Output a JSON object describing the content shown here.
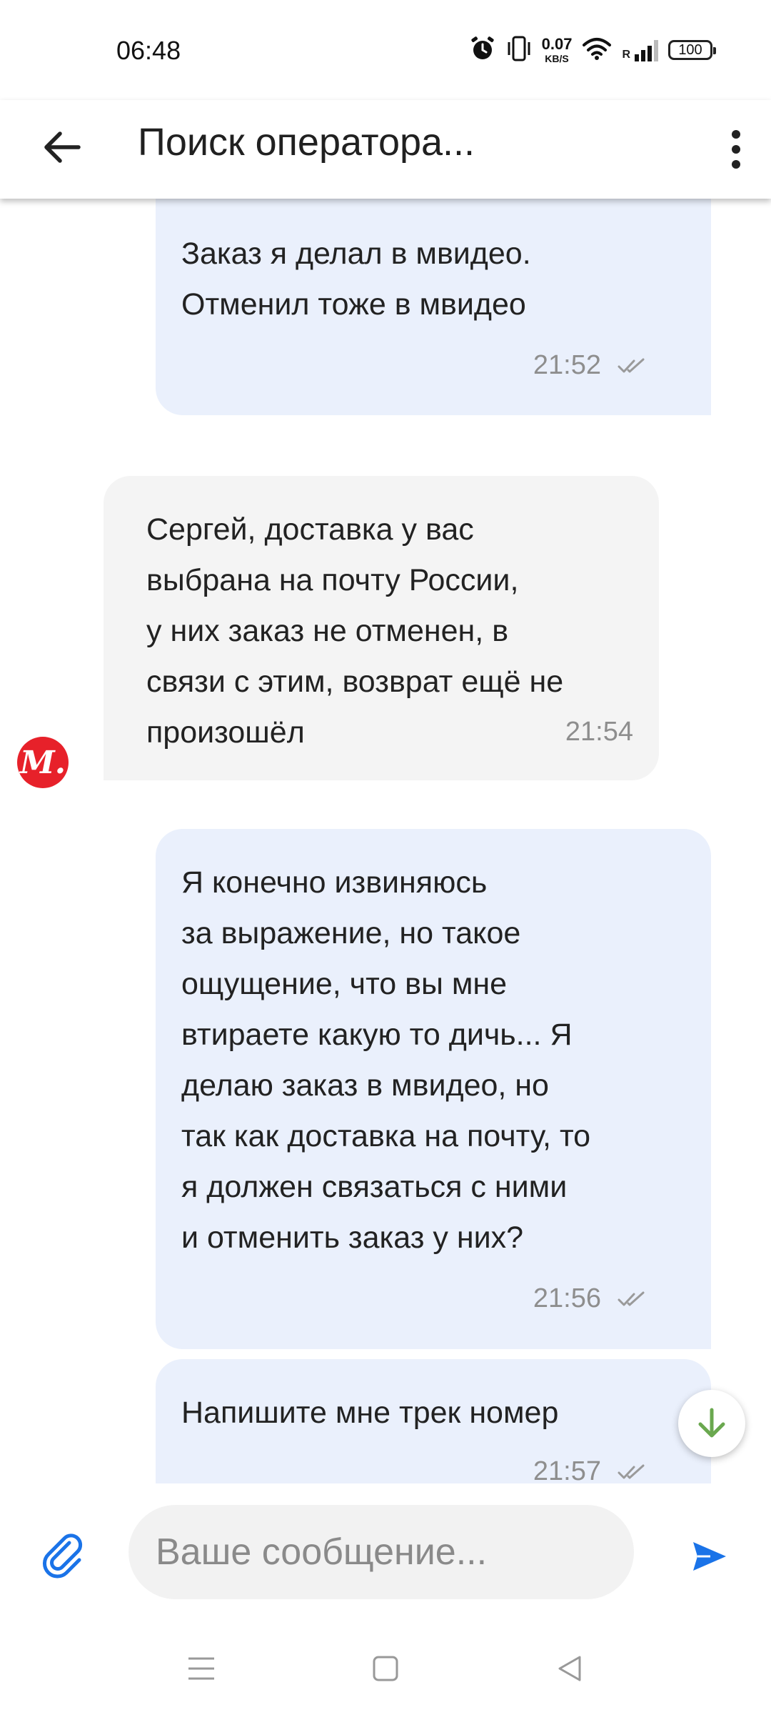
{
  "status_bar": {
    "time": "06:48",
    "net_speed_value": "0.07",
    "net_speed_unit": "KB/S",
    "signal_label": "R",
    "battery": "100"
  },
  "header": {
    "title": "Поиск оператора..."
  },
  "messages": [
    {
      "direction": "out",
      "text": "Заказ я делал в мвидео.\nОтменил тоже в мвидео",
      "time": "21:52",
      "read": true
    },
    {
      "direction": "in",
      "text": "Сергей, доставка у вас\nвыбрана на почту России,\nу них заказ не отменен, в\nсвязи с этим, возврат ещё не\nпроизошёл",
      "time": "21:54"
    },
    {
      "direction": "out",
      "text": "Я конечно извиняюсь\nза выражение, но такое\nощущение, что вы мне\nвтираете какую то дичь... Я\nделаю заказ в мвидео, но\nтак как доставка на почту, то\nя должен связаться с ними\nи отменить заказ у них?",
      "time": "21:56",
      "read": true
    },
    {
      "direction": "out",
      "text": "Напишите мне трек номер",
      "time": "21:57",
      "read": true
    }
  ],
  "operator_avatar": {
    "letter": "М.",
    "color": "#e7212a"
  },
  "composer": {
    "placeholder": "Ваше сообщение..."
  },
  "colors": {
    "accent": "#1a73e8",
    "outgoing_bubble": "#eaf0fc",
    "incoming_bubble": "#f4f4f4",
    "scroll_arrow": "#6aa84f"
  },
  "icons": [
    "back-arrow-icon",
    "more-vertical-icon",
    "alarm-icon",
    "vibrate-icon",
    "wifi-icon",
    "signal-icon",
    "battery-icon",
    "read-check-icon",
    "paperclip-icon",
    "send-icon",
    "arrow-down-icon",
    "menu-icon",
    "home-square-icon",
    "back-triangle-icon"
  ]
}
